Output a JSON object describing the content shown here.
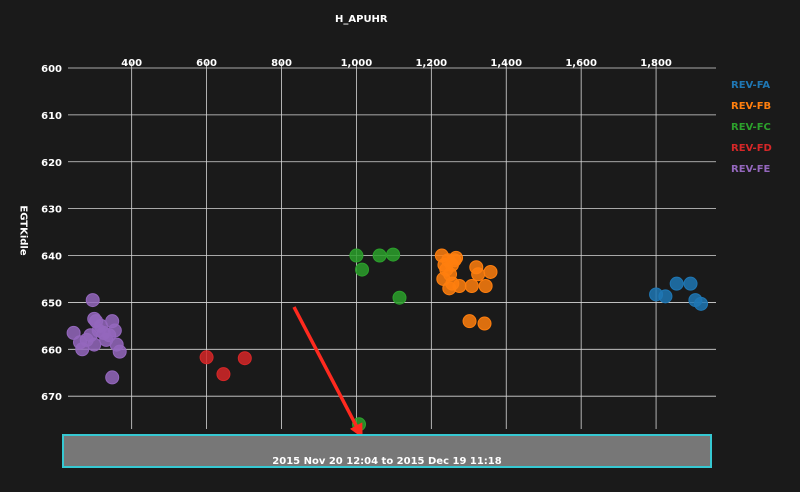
{
  "chart_data": {
    "type": "scatter",
    "xlabel": "H_APUHR",
    "ylabel": "EGTKidle",
    "xlim": [
      230,
      1960
    ],
    "ylim": [
      600,
      677
    ],
    "y_inverted": true,
    "x_axis_position": "top",
    "x_ticks": [
      400,
      600,
      800,
      1000,
      1200,
      1400,
      1600,
      1800
    ],
    "x_tick_labels": [
      "400",
      "600",
      "800",
      "1,000",
      "1,200",
      "1,400",
      "1,600",
      "1,800"
    ],
    "y_ticks": [
      600,
      610,
      620,
      630,
      640,
      650,
      660,
      670
    ],
    "y_tick_labels": [
      "600",
      "610",
      "620",
      "630",
      "640",
      "650",
      "660",
      "670"
    ],
    "grid": true,
    "legend_position": "right",
    "series": [
      {
        "name": "REV-FA",
        "color": "#1f77b4",
        "points": [
          [
            1800,
            648.3
          ],
          [
            1825,
            648.7
          ],
          [
            1855,
            646
          ],
          [
            1892,
            646
          ],
          [
            1905,
            649.5
          ],
          [
            1920,
            650.3
          ]
        ]
      },
      {
        "name": "REV-FB",
        "color": "#ff7f0e",
        "points": [
          [
            1228,
            640
          ],
          [
            1235,
            642
          ],
          [
            1232,
            645
          ],
          [
            1240,
            643
          ],
          [
            1245,
            641
          ],
          [
            1250,
            644
          ],
          [
            1255,
            642
          ],
          [
            1262,
            641
          ],
          [
            1266,
            640.5
          ],
          [
            1248,
            647
          ],
          [
            1256,
            646
          ],
          [
            1275,
            646.5
          ],
          [
            1308,
            646.5
          ],
          [
            1320,
            642.5
          ],
          [
            1325,
            644
          ],
          [
            1345,
            646.5
          ],
          [
            1358,
            643.5
          ],
          [
            1302,
            654
          ],
          [
            1342,
            654.5
          ]
        ]
      },
      {
        "name": "REV-FC",
        "color": "#2ca02c",
        "points": [
          [
            1000,
            640
          ],
          [
            1015,
            643
          ],
          [
            1062,
            640
          ],
          [
            1098,
            639.8
          ],
          [
            1115,
            649
          ],
          [
            1007,
            676
          ]
        ]
      },
      {
        "name": "REV-FD",
        "color": "#d62728",
        "points": [
          [
            600,
            661.7
          ],
          [
            645,
            665.3
          ],
          [
            702,
            661.9
          ]
        ]
      },
      {
        "name": "REV-FE",
        "color": "#9467bd",
        "points": [
          [
            245,
            656.5
          ],
          [
            262,
            658.5
          ],
          [
            268,
            660
          ],
          [
            280,
            658
          ],
          [
            290,
            657
          ],
          [
            300,
            659
          ],
          [
            305,
            654
          ],
          [
            312,
            656
          ],
          [
            318,
            655
          ],
          [
            325,
            656.5
          ],
          [
            332,
            658
          ],
          [
            340,
            657
          ],
          [
            348,
            654
          ],
          [
            355,
            656
          ],
          [
            360,
            659
          ],
          [
            368,
            660.5
          ],
          [
            296,
            649.5
          ],
          [
            348,
            666
          ],
          [
            300,
            653.5
          ]
        ]
      }
    ]
  },
  "time_range": {
    "label": "2015 Nov 20 12:04 to 2015 Dec 19 11:18"
  },
  "annotation": {
    "arrow_color": "#ff2a1f"
  }
}
